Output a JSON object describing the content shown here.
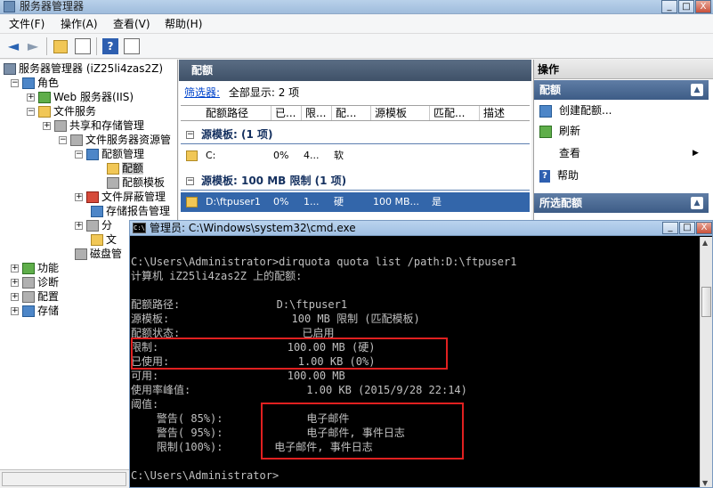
{
  "window": {
    "title": "服务器管理器",
    "min": "_",
    "max": "□",
    "close": "X"
  },
  "menu": [
    "文件(F)",
    "操作(A)",
    "查看(V)",
    "帮助(H)"
  ],
  "toolbar": {
    "back": "◄",
    "forward": "►",
    "help": "?"
  },
  "tree": {
    "root": "服务器管理器 (iZ25li4zas2Z)",
    "nodes": [
      {
        "label": "角色"
      },
      {
        "label": "Web 服务器(IIS)"
      },
      {
        "label": "文件服务"
      },
      {
        "label": "共享和存储管理"
      },
      {
        "label": "文件服务器资源管"
      },
      {
        "label": "配额管理"
      },
      {
        "label": "配额"
      },
      {
        "label": "配额模板"
      },
      {
        "label": "文件屏蔽管理"
      },
      {
        "label": "存储报告管理"
      },
      {
        "label": "分"
      },
      {
        "label": "文"
      },
      {
        "label": "磁盘管"
      },
      {
        "label": "功能"
      },
      {
        "label": "诊断"
      },
      {
        "label": "配置"
      },
      {
        "label": "存储"
      }
    ],
    "expander_minus": "−",
    "expander_plus": "+"
  },
  "center": {
    "header": "配额",
    "filter_link": "筛选器:",
    "filter_text": "全部显示: 2 项",
    "columns": [
      "配额路径",
      "已...",
      "限...",
      "配...",
      "源模板",
      "匹配...",
      "描述"
    ],
    "groups": [
      {
        "label": "源模板:  (1 项)",
        "rows": [
          {
            "path": "C:",
            "used": "0%",
            "limit": "4...",
            "type": "软",
            "template": "",
            "match": ""
          }
        ]
      },
      {
        "label": "源模板: 100 MB 限制 (1 项)",
        "rows": [
          {
            "path": "D:\\ftpuser1",
            "used": "0%",
            "limit": "1...",
            "type": "硬",
            "template": "100 MB...",
            "match": "是"
          }
        ]
      }
    ]
  },
  "actions": {
    "title": "操作",
    "section1": "配额",
    "items": [
      "创建配额...",
      "刷新",
      "查看",
      "帮助"
    ],
    "submenu_arrow": "▶",
    "section2": "所选配额",
    "collapse_glyph": "▲"
  },
  "cmd": {
    "title": "管理员: C:\\Windows\\system32\\cmd.exe",
    "icon_text": "C:\\",
    "lines": [
      "C:\\Users\\Administrator>dirquota quota list /path:D:\\ftpuser1",
      "计算机 iZ25li4zas2Z 上的配额:",
      "",
      "配额路径:               D:\\ftpuser1",
      "源模板:                   100 MB 限制 (匹配模板)",
      "配额状态:                   已启用",
      "限制:                    100.00 MB (硬)",
      "已使用:                    1.00 KB (0%)",
      "可用:                    100.00 MB",
      "使用率峰值:                  1.00 KB (2015/9/28 22:14)",
      "阈值:",
      "    警告( 85%):             电子邮件",
      "    警告( 95%):             电子邮件, 事件日志",
      "    限制(100%):        电子邮件, 事件日志",
      "",
      "C:\\Users\\Administrator>"
    ]
  },
  "colors": {
    "highlight": "#e02020",
    "pane_header": "#3f5168",
    "selection": "#3366aa",
    "cmd_text": "#c0c0c0"
  }
}
